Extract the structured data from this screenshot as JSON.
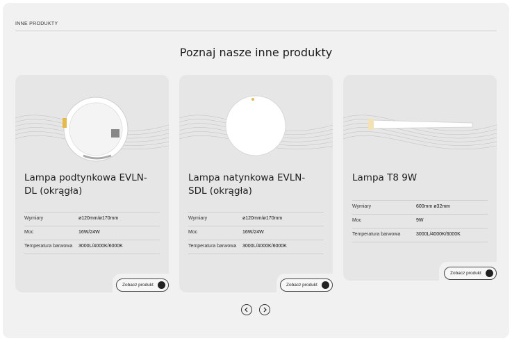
{
  "section": {
    "label": "INNE PRODUKTY",
    "heading": "Poznaj nasze inne produkty"
  },
  "cards": [
    {
      "title": "Lampa podtynkowa EVLN-DL (okrągła)",
      "title_lines": [
        "Lampa podtynkowa EVLN-",
        "DL (okrągła)"
      ],
      "specs": [
        {
          "label": "Wymiary",
          "value": "ø120mm/ø170mm"
        },
        {
          "label": "Moc",
          "value": "16W/24W"
        },
        {
          "label": "Temperatura barwowa",
          "value": "3000L/4000K/6000K"
        }
      ],
      "button": "Zobacz produkt"
    },
    {
      "title": "Lampa natynkowa EVLN-SDL (okrągła)",
      "title_lines": [
        "Lampa natynkowa EVLN-",
        "SDL (okrągła)"
      ],
      "specs": [
        {
          "label": "Wymiary",
          "value": "ø120mm/ø170mm"
        },
        {
          "label": "Moc",
          "value": "16W/24W"
        },
        {
          "label": "Temperatura barwowa",
          "value": "3000L/4000K/6000K"
        }
      ],
      "button": "Zobacz produkt"
    },
    {
      "title": "Lampa T8 9W",
      "specs": [
        {
          "label": "Wymiary",
          "value": "600mm ø32mm"
        },
        {
          "label": "Moc",
          "value": "9W"
        },
        {
          "label": "Temperatura barwowa",
          "value": "3000L/4000K/6000K"
        }
      ],
      "button": "Zobacz produkt"
    }
  ],
  "icons": {
    "prev": "chevron-left-icon",
    "next": "chevron-right-icon",
    "button_arrow": "arrow-down-right-icon"
  },
  "colors": {
    "panel": "#f1f1f1",
    "card": "#e6e6e6",
    "text": "#1d1d1d"
  }
}
